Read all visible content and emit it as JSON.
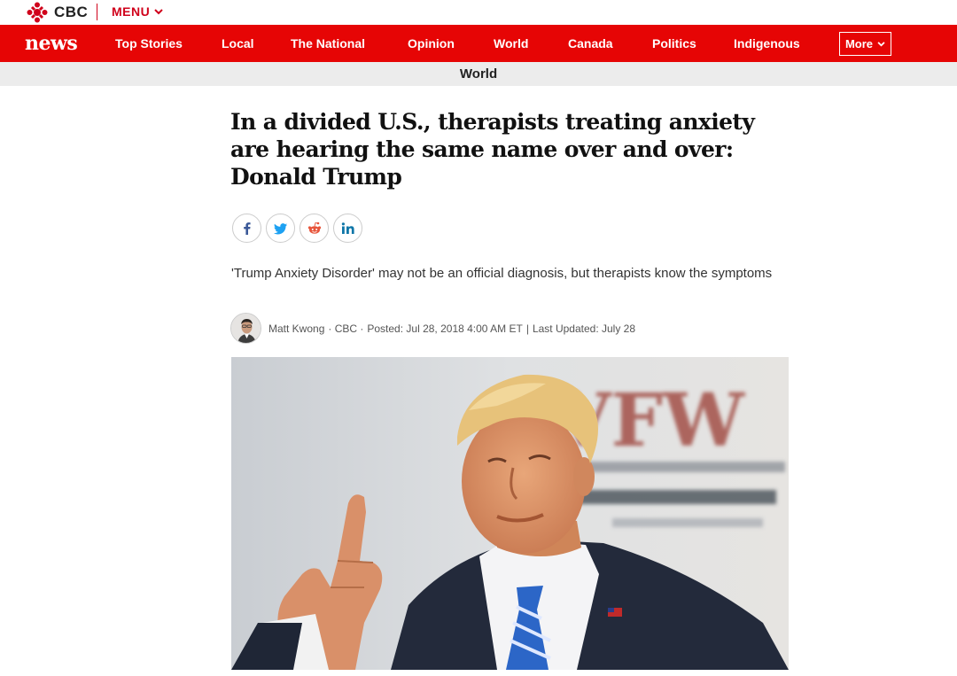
{
  "topbar": {
    "brand": "CBC",
    "menu_label": "MENU"
  },
  "nav": {
    "brand": "news",
    "items": [
      "Top Stories",
      "Local",
      "The National",
      "Opinion",
      "World",
      "Canada",
      "Politics",
      "Indigenous"
    ],
    "more_label": "More"
  },
  "section": {
    "label": "World"
  },
  "article": {
    "headline": "In a divided U.S., therapists treating anxiety are hearing the same name over and over: Donald Trump",
    "deck": "'Trump Anxiety Disorder' may not be an official diagnosis, but therapists know the symptoms",
    "byline": {
      "author": "Matt Kwong",
      "outlet": "· CBC ·",
      "posted": "Posted: Jul 28, 2018 4:00 AM ET",
      "separator": "|",
      "updated": "Last Updated: July 28"
    },
    "hero_sign_text": "VFW"
  },
  "share": {
    "icons": [
      "facebook-icon",
      "twitter-icon",
      "reddit-icon",
      "linkedin-icon"
    ]
  },
  "colors": {
    "brand_red": "#e60505",
    "section_bg": "#ececec"
  }
}
